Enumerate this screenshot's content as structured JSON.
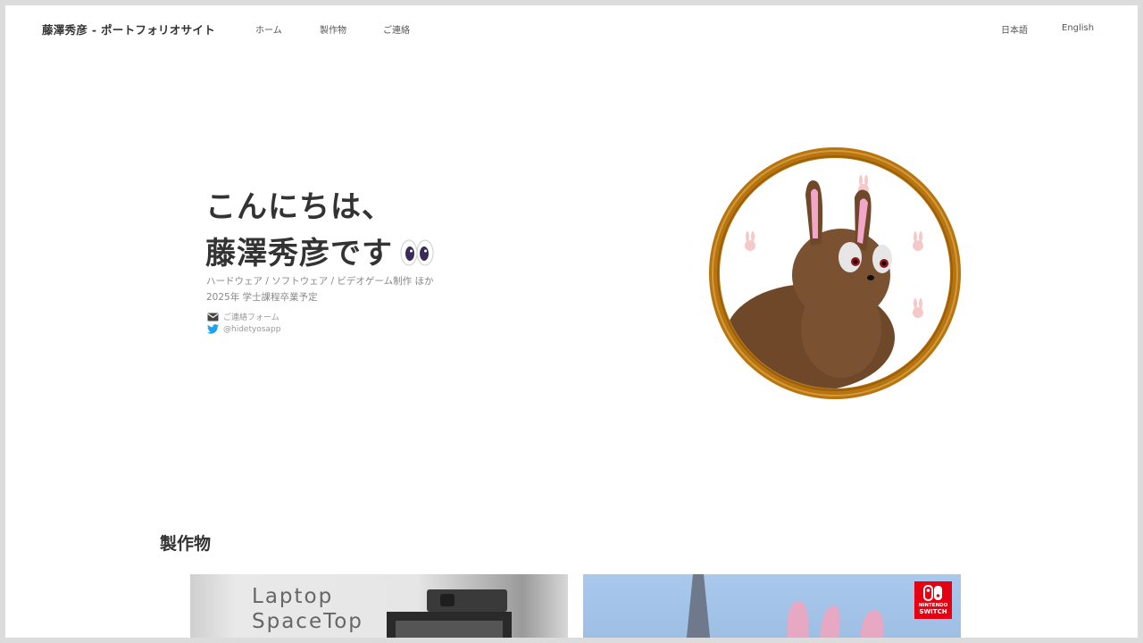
{
  "header": {
    "site_title": "藤澤秀彦 - ポートフォリオサイト",
    "nav": [
      "ホーム",
      "製作物",
      "ご連絡"
    ],
    "lang": [
      "日本語",
      "English"
    ]
  },
  "hero": {
    "greeting_line1": "こんにちは、",
    "greeting_line2": "藤澤秀彦です",
    "subtitle": "ハードウェア / ソフトウェア / ビデオゲーム制作 ほか",
    "graduation": "2025年 学士課程卒業予定",
    "contact_label": "ご連絡フォーム",
    "twitter_handle": "@hidetyosapp"
  },
  "works": {
    "title": "製作物",
    "card1_line1": "Laptop",
    "card1_line2": "SpaceTop",
    "card2_badge_line1": "NINTENDO",
    "card2_badge_line2": "SWITCH"
  },
  "colors": {
    "frame_ring": "#b8740f",
    "bunny_fur": "#7a5232",
    "bunny_ear_inner": "#f2a6c9",
    "twitter_blue": "#1da1f2",
    "switch_red": "#e60012"
  },
  "icons": [
    "mail-icon",
    "twitter-icon",
    "eyes-emoji-icon",
    "nintendo-switch-logo-icon"
  ]
}
